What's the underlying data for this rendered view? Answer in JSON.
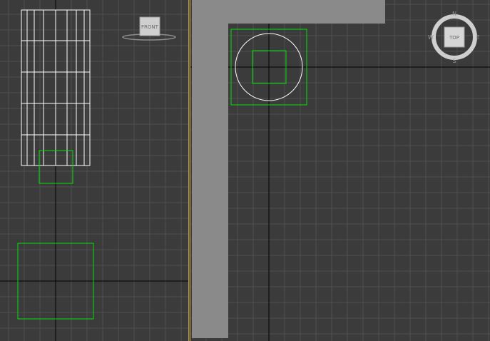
{
  "viewports": {
    "front": {
      "cube_label": "FRONT"
    },
    "top": {
      "cube_label": "TOP",
      "compass": {
        "north": "N",
        "south": "S",
        "east": "E",
        "west": "W"
      }
    }
  },
  "colors": {
    "background": "#3b3b3b",
    "grid": "#4f4f4f",
    "axis": "#000000",
    "wireframe": "#ffffff",
    "selection": "#00e000",
    "wall": "#8a8a8a",
    "divider": "#b39a4a"
  }
}
